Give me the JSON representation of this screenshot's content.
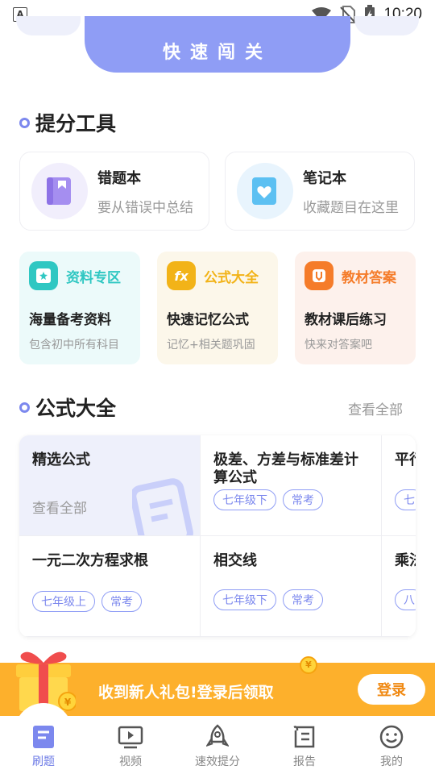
{
  "status_bar": {
    "time": "10:20"
  },
  "top": {
    "quick_challenge": "快速闯关"
  },
  "tools_section": {
    "title": "提分工具",
    "cards": [
      {
        "title": "错题本",
        "subtitle": "要从错误中总结"
      },
      {
        "title": "笔记本",
        "subtitle": "收藏题目在这里"
      }
    ]
  },
  "features": [
    {
      "label": "资料专区",
      "title": "海量备考资料",
      "subtitle": "包含初中所有科目",
      "color": "#2fc7c2"
    },
    {
      "label": "公式大全",
      "title": "快速记忆公式",
      "subtitle": "记忆+相关题巩固",
      "color": "#f2b318"
    },
    {
      "label": "教材答案",
      "title": "教材课后练习",
      "subtitle": "快来对答案吧",
      "color": "#f57c2a"
    }
  ],
  "formula_section": {
    "title": "公式大全",
    "view_all": "查看全部",
    "featured": {
      "title": "精选公式",
      "subtitle": "查看全部"
    },
    "items": [
      {
        "title": "极差、方差与标准差计算公式",
        "tags": [
          "七年级下",
          "常考"
        ]
      },
      {
        "title": "平行",
        "tags": [
          "七"
        ]
      },
      {
        "title": "一元二次方程求根",
        "tags": [
          "七年级上",
          "常考"
        ]
      },
      {
        "title": "相交线",
        "tags": [
          "七年级下",
          "常考"
        ]
      },
      {
        "title": "乘法",
        "tags": [
          "八"
        ]
      }
    ]
  },
  "gift_banner": {
    "text": "收到新人礼包!登录后领取",
    "login": "登录"
  },
  "nav": [
    {
      "label": "刷题",
      "icon": "book-icon"
    },
    {
      "label": "视频",
      "icon": "video-icon"
    },
    {
      "label": "速效提分",
      "icon": "rocket-icon"
    },
    {
      "label": "报告",
      "icon": "report-icon"
    },
    {
      "label": "我的",
      "icon": "smile-icon"
    }
  ],
  "colors": {
    "accent": "#8f9df5",
    "banner": "#fdb02c"
  }
}
